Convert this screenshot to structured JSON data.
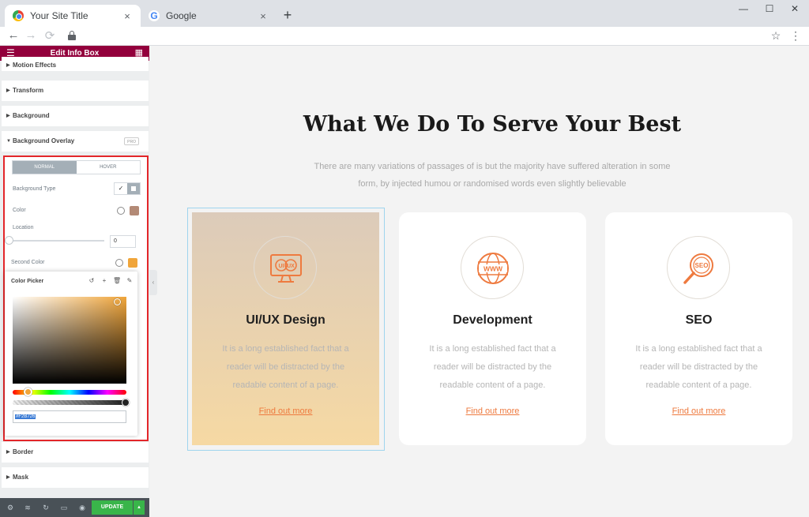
{
  "browser": {
    "tabs": [
      {
        "title": "Your Site Title",
        "active": true
      },
      {
        "title": "Google",
        "active": false
      }
    ],
    "close_glyph": "×",
    "new_tab_glyph": "+",
    "window_controls": [
      "—",
      "☐",
      "✕"
    ],
    "nav": {
      "back": "←",
      "forward": "→",
      "reload": "⟳"
    },
    "star_glyph": "☆",
    "menu_glyph": "⋮"
  },
  "editor": {
    "title": "Edit Info Box",
    "menu_glyph": "☰",
    "grid_glyph": "▦",
    "sections": {
      "motion_effects": "Motion Effects",
      "transform": "Transform",
      "background": "Background",
      "background_overlay": "Background Overlay",
      "border": "Border",
      "mask": "Mask"
    },
    "pro_badge": "PRO",
    "caret_right": "▶",
    "caret_down": "▼",
    "overlay": {
      "tabs": [
        "NORMAL",
        "HOVER"
      ],
      "active_tab": "NORMAL",
      "background_type_label": "Background Type",
      "background_type_classic_glyph": "✓",
      "color_label": "Color",
      "color_value": "#b38a76",
      "location_label": "Location",
      "location_value": "0",
      "second_color_label": "Second Color",
      "second_color_value": "#f0a53a"
    },
    "color_picker": {
      "title": "Color Picker",
      "tools": [
        "↺",
        "+",
        "🗑",
        "✎"
      ],
      "hue_color": "#f0a53a",
      "hex_value": "#F2B726"
    },
    "collapse_glyph": "‹",
    "footer": {
      "icons": [
        "⚙",
        "≋",
        "↻",
        "▭",
        "◉"
      ],
      "update_label": "UPDATE",
      "update_caret": "▲"
    }
  },
  "page": {
    "title": "What We Do To Serve Your Best",
    "intro": "There are many variations of passages of is but the majority have suffered alteration in some form, by injected humou or randomised words even slightly believable",
    "accent_color": "#ee7a3f",
    "cards": [
      {
        "title": "UI/UX Design",
        "text": "It is a long established fact that a reader will be distracted by the readable content of a page.",
        "link": "Find out more",
        "icon": "ui-ux-monitor-icon"
      },
      {
        "title": "Development",
        "text": "It is a long established fact that a reader will be distracted by the readable content of a page.",
        "link": "Find out more",
        "icon": "www-globe-icon"
      },
      {
        "title": "SEO",
        "text": "It is a long established fact that a reader will be distracted by the readable content of a page.",
        "link": "Find out more",
        "icon": "seo-magnifier-icon"
      }
    ]
  }
}
